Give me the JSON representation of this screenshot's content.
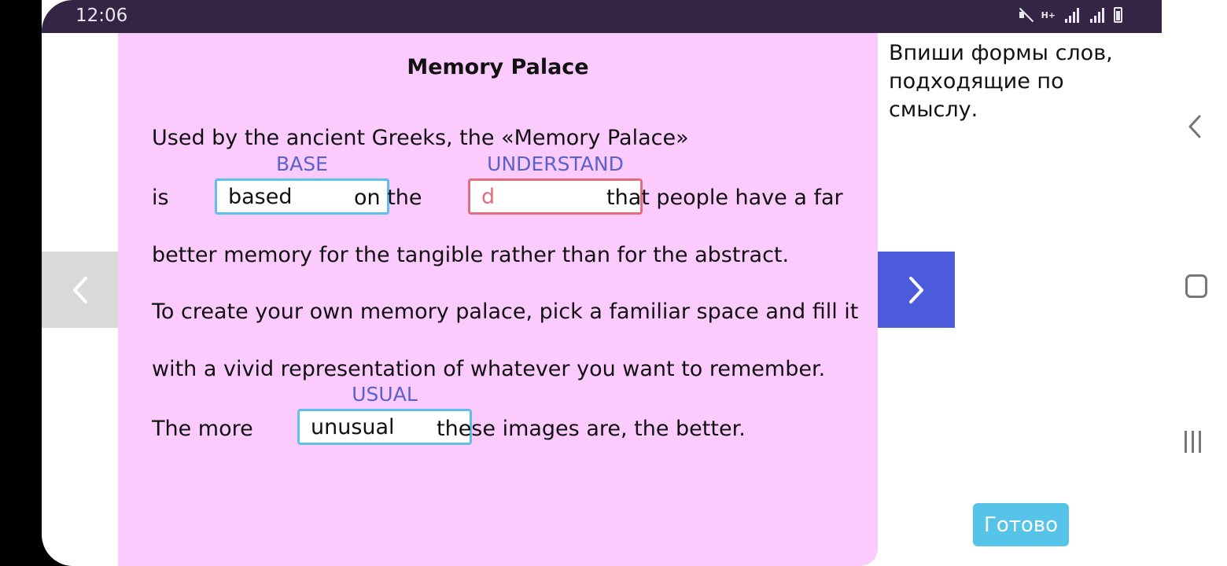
{
  "status_bar": {
    "time": "12:06",
    "network_label": "H+"
  },
  "lesson": {
    "title": "Memory Palace",
    "line1": "Used by the ancient Greeks, the «Memory Palace»",
    "line2_is": "is",
    "gap1": {
      "hint": "BASE",
      "value": "based"
    },
    "line2_on_the": "on the",
    "gap2": {
      "hint": "UNDERSTAND",
      "value": "d"
    },
    "line2_rest": "that people have a far",
    "line3": "better memory for the tangible rather than for the abstract.",
    "line4": "To create your own memory palace, pick a familiar space and fill it",
    "line5": "with a vivid representation of whatever you want to remember.",
    "line6_start": "The more",
    "gap3": {
      "hint": "USUAL",
      "value": "unusual"
    },
    "line6_end": "these images are, the better."
  },
  "instruction": "Впиши формы слов, подходящие по смыслу.",
  "done_button": "Готово",
  "colors": {
    "panel_bg": "#fccbfd",
    "hint": "#5b61cc",
    "gap_ok_border": "#5ec0e6",
    "gap_error_border": "#e56b7f",
    "next_button": "#4b5bdc",
    "done_button": "#56c3e8",
    "status_bar": "#332543"
  }
}
